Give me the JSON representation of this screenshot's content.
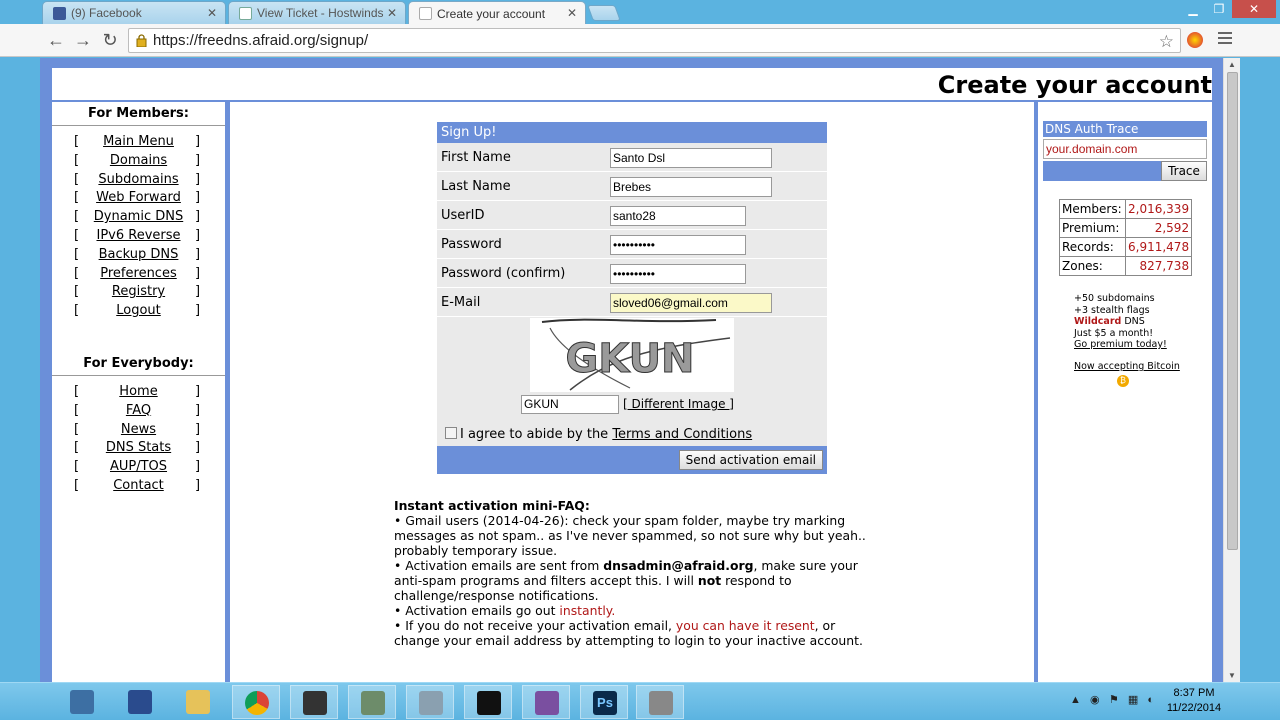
{
  "browser": {
    "tabs": [
      {
        "title": "(9) Facebook",
        "active": false
      },
      {
        "title": "View Ticket - Hostwinds",
        "active": false
      },
      {
        "title": "Create your account",
        "active": true
      }
    ],
    "url": "https://freedns.afraid.org/signup/"
  },
  "page": {
    "title": "Create your account",
    "members_heading": "For Members:",
    "members_links": [
      "Main Menu",
      "Domains",
      "Subdomains",
      "Web Forward",
      "Dynamic DNS",
      "IPv6 Reverse",
      "Backup DNS",
      "Preferences",
      "Registry",
      "Logout"
    ],
    "everybody_heading": "For Everybody:",
    "everybody_links": [
      "Home",
      "FAQ",
      "News",
      "DNS Stats",
      "AUP/TOS",
      "Contact"
    ],
    "bracket_open": "[",
    "bracket_close": "]"
  },
  "signup": {
    "heading": "Sign Up!",
    "first_name_label": "First Name",
    "first_name_value": "Santo Dsl",
    "last_name_label": "Last Name",
    "last_name_value": "Brebes",
    "userid_label": "UserID",
    "userid_value": "santo28",
    "password_label": "Password",
    "password_value": "••••••••••",
    "password_confirm_label": "Password (confirm)",
    "password_confirm_value": "••••••••••",
    "email_label": "E-Mail",
    "email_value": "sloved06@gmail.com",
    "captcha_image_text": "GKUN",
    "captcha_value": "GKUN",
    "different_image": "[ Different Image ]",
    "agree_text": "I agree to abide by the ",
    "terms_link": "Terms and Conditions",
    "submit": "Send activation email"
  },
  "faq": {
    "heading": "Instant activation mini-FAQ:",
    "item1": "• Gmail users (2014-04-26): check your spam folder, maybe try marking messages as not spam.. as I've never spammed, so not sure why but yeah.. probably temporary issue.",
    "item2_a": "• Activation emails are sent from ",
    "item2_email": "dnsadmin@afraid.org",
    "item2_b": ", make sure your anti-spam programs and filters accept this. I will ",
    "item2_not": "not",
    "item2_c": " respond to challenge/response notifications.",
    "item3_a": "• Activation emails go out ",
    "item3_red": "instantly.",
    "item4_a": "• If you do not receive your activation email, ",
    "item4_red": "you can have it resent",
    "item4_b": ", or change your email address by attempting to login to your inactive account."
  },
  "sidebar_right": {
    "trace_heading": "DNS Auth Trace",
    "trace_input": "your.domain.com",
    "trace_button": "Trace",
    "stats": [
      {
        "label": "Members:",
        "value": "2,016,339"
      },
      {
        "label": "Premium:",
        "value": "2,592"
      },
      {
        "label": "Records:",
        "value": "6,911,478"
      },
      {
        "label": "Zones:",
        "value": "827,738"
      }
    ],
    "promo_1": "+50 subdomains",
    "promo_2": "+3 stealth flags",
    "promo_3_wild": "Wildcard",
    "promo_3_rest": " DNS",
    "promo_4": "Just $5 a month!",
    "promo_5": "Go premium today!",
    "bitcoin": "Now accepting Bitcoin"
  },
  "taskbar": {
    "time": "8:37 PM",
    "date": "11/22/2014"
  },
  "colors": {
    "accent_blue": "#6b8fd9",
    "red_text": "#b01818",
    "os_blue": "#5bb3e0"
  }
}
